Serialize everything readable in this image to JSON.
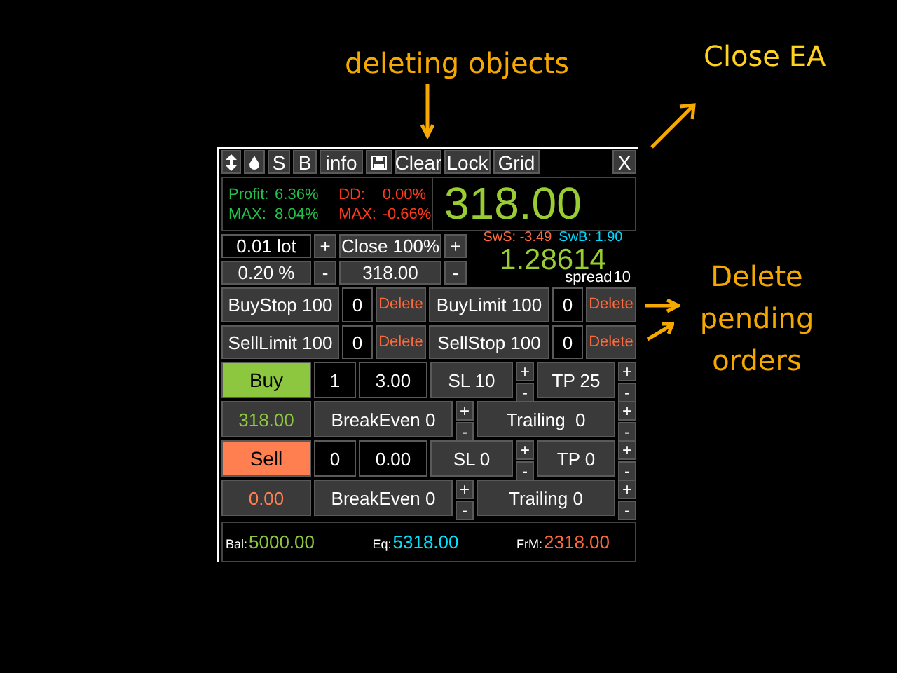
{
  "annotations": [
    {
      "text": "deleting objects"
    },
    {
      "text": "Close EA"
    },
    {
      "text": "Delete pending orders"
    }
  ],
  "toolbar": {
    "buttons": [
      "S",
      "B",
      "info",
      "Clear",
      "Lock",
      "Grid"
    ],
    "close": "X"
  },
  "stats": {
    "profit_label": "Profit:",
    "profit": "6.36%",
    "max_label": "MAX:",
    "max": "8.04%",
    "dd_label": "DD:",
    "dd": "0.00%",
    "dd_max_label": "MAX:",
    "dd_max": "-0.66%",
    "total": "318.00"
  },
  "order": {
    "lot": "0.01 lot",
    "lot_plus": "+",
    "close": "Close 100%",
    "close_plus": "+",
    "risk": "0.20 %",
    "risk_minus": "-",
    "close_amount": "318.00",
    "close_minus": "-"
  },
  "quote": {
    "sws": "SwS: -3.49",
    "swb": "SwB: 1.90",
    "price": "1.28614",
    "spread_label": "spread",
    "spread": "10"
  },
  "pending": [
    {
      "label": "BuyStop 100",
      "count": "0",
      "delete": "Delete"
    },
    {
      "label": "BuyLimit 100",
      "count": "0",
      "delete": "Delete"
    },
    {
      "label": "SellLimit 100",
      "count": "0",
      "delete": "Delete"
    },
    {
      "label": "SellStop 100",
      "count": "0",
      "delete": "Delete"
    }
  ],
  "trades": [
    {
      "kind": "buy",
      "action": "Buy",
      "count": "1",
      "lots": "3.00",
      "sl": "SL 10",
      "sl_step": [
        "+",
        "-"
      ],
      "tp": "TP 25",
      "tp_step": [
        "+",
        "-"
      ],
      "profit": "318.00",
      "breakeven": "BreakEven 0",
      "be_step": [
        "+",
        "-"
      ],
      "trailing": "Trailing  0",
      "tr_step": [
        "+",
        "-"
      ]
    },
    {
      "kind": "sell",
      "action": "Sell",
      "count": "0",
      "lots": "0.00",
      "sl": "SL 0",
      "sl_step": [
        "+",
        "-"
      ],
      "tp": "TP 0",
      "tp_step": [
        "+",
        "-"
      ],
      "profit": "0.00",
      "breakeven": "BreakEven 0",
      "be_step": [
        "+",
        "-"
      ],
      "trailing": "Trailing 0",
      "tr_step": [
        "+",
        "-"
      ]
    }
  ],
  "footer": [
    {
      "label": "Bal:",
      "value": "5000.00",
      "color": "#8dc63f"
    },
    {
      "label": "Eq:",
      "value": "5318.00",
      "color": "#00e5ff"
    },
    {
      "label": "FrM:",
      "value": "2318.00",
      "color": "#ff6a3d"
    }
  ]
}
